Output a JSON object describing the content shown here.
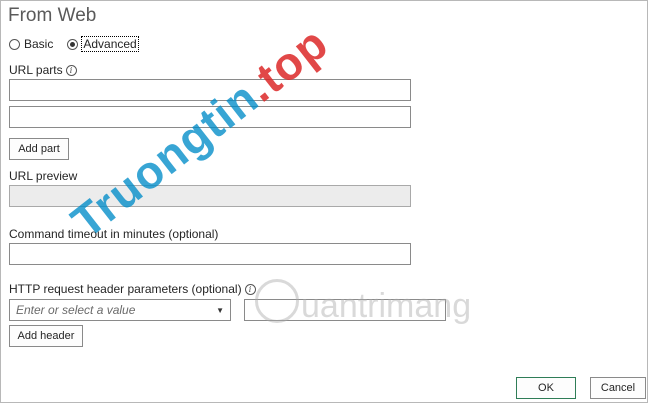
{
  "dialog": {
    "title": "From Web",
    "mode": {
      "basic_label": "Basic",
      "advanced_label": "Advanced",
      "selected": "Advanced"
    },
    "url_parts": {
      "label": "URL parts",
      "part1_value": "",
      "part2_value": "",
      "add_part_label": "Add part"
    },
    "url_preview": {
      "label": "URL preview",
      "value": ""
    },
    "timeout": {
      "label": "Command timeout in minutes (optional)",
      "value": ""
    },
    "http_headers": {
      "label": "HTTP request header parameters (optional)",
      "key_placeholder": "Enter or select a value",
      "value": "",
      "add_header_label": "Add header"
    },
    "ok_label": "OK",
    "cancel_label": "Cancel"
  },
  "watermarks": {
    "primary_text": "Truongtin",
    "primary_accent": ".top",
    "secondary_text": "uantrimang"
  },
  "colors": {
    "watermark_blue": "#008cc8",
    "watermark_red": "#dc2828",
    "ok_border": "#2f7d57"
  }
}
